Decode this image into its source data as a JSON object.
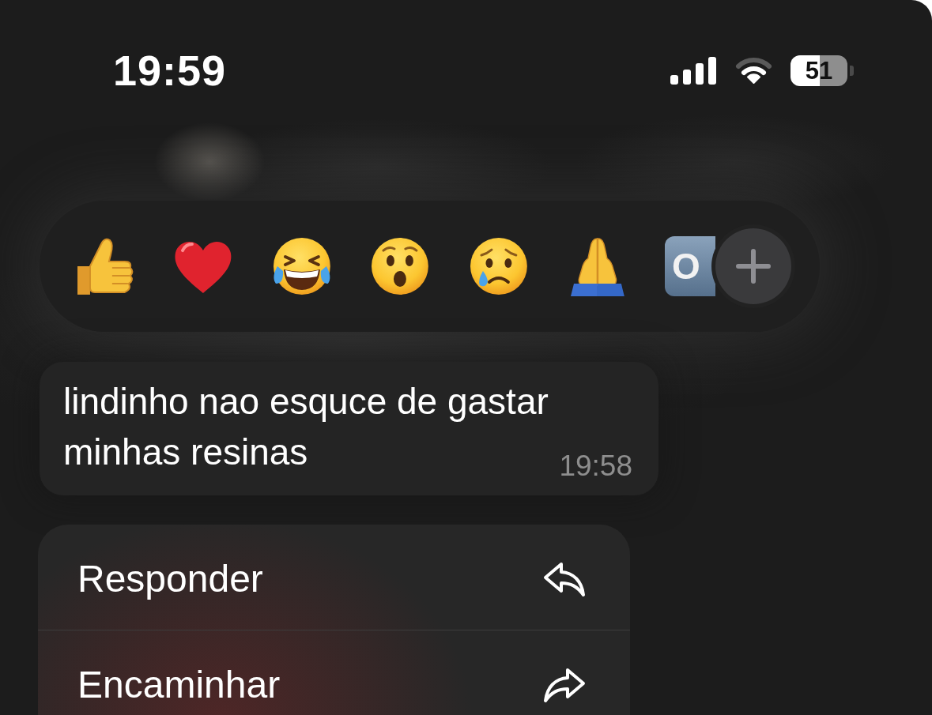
{
  "status_bar": {
    "time": "19:59",
    "battery": "51"
  },
  "reactions": [
    {
      "kind": "thumbs_up"
    },
    {
      "kind": "heart"
    },
    {
      "kind": "laughing"
    },
    {
      "kind": "surprised"
    },
    {
      "kind": "crying"
    },
    {
      "kind": "praying"
    },
    {
      "kind": "tile",
      "label": "O"
    }
  ],
  "message": {
    "text": "lindinho nao esquce de gastar minhas resinas",
    "time": "19:58"
  },
  "menu": {
    "items": [
      {
        "kind": "reply",
        "label": "Responder"
      },
      {
        "kind": "forward",
        "label": "Encaminhar"
      }
    ]
  }
}
